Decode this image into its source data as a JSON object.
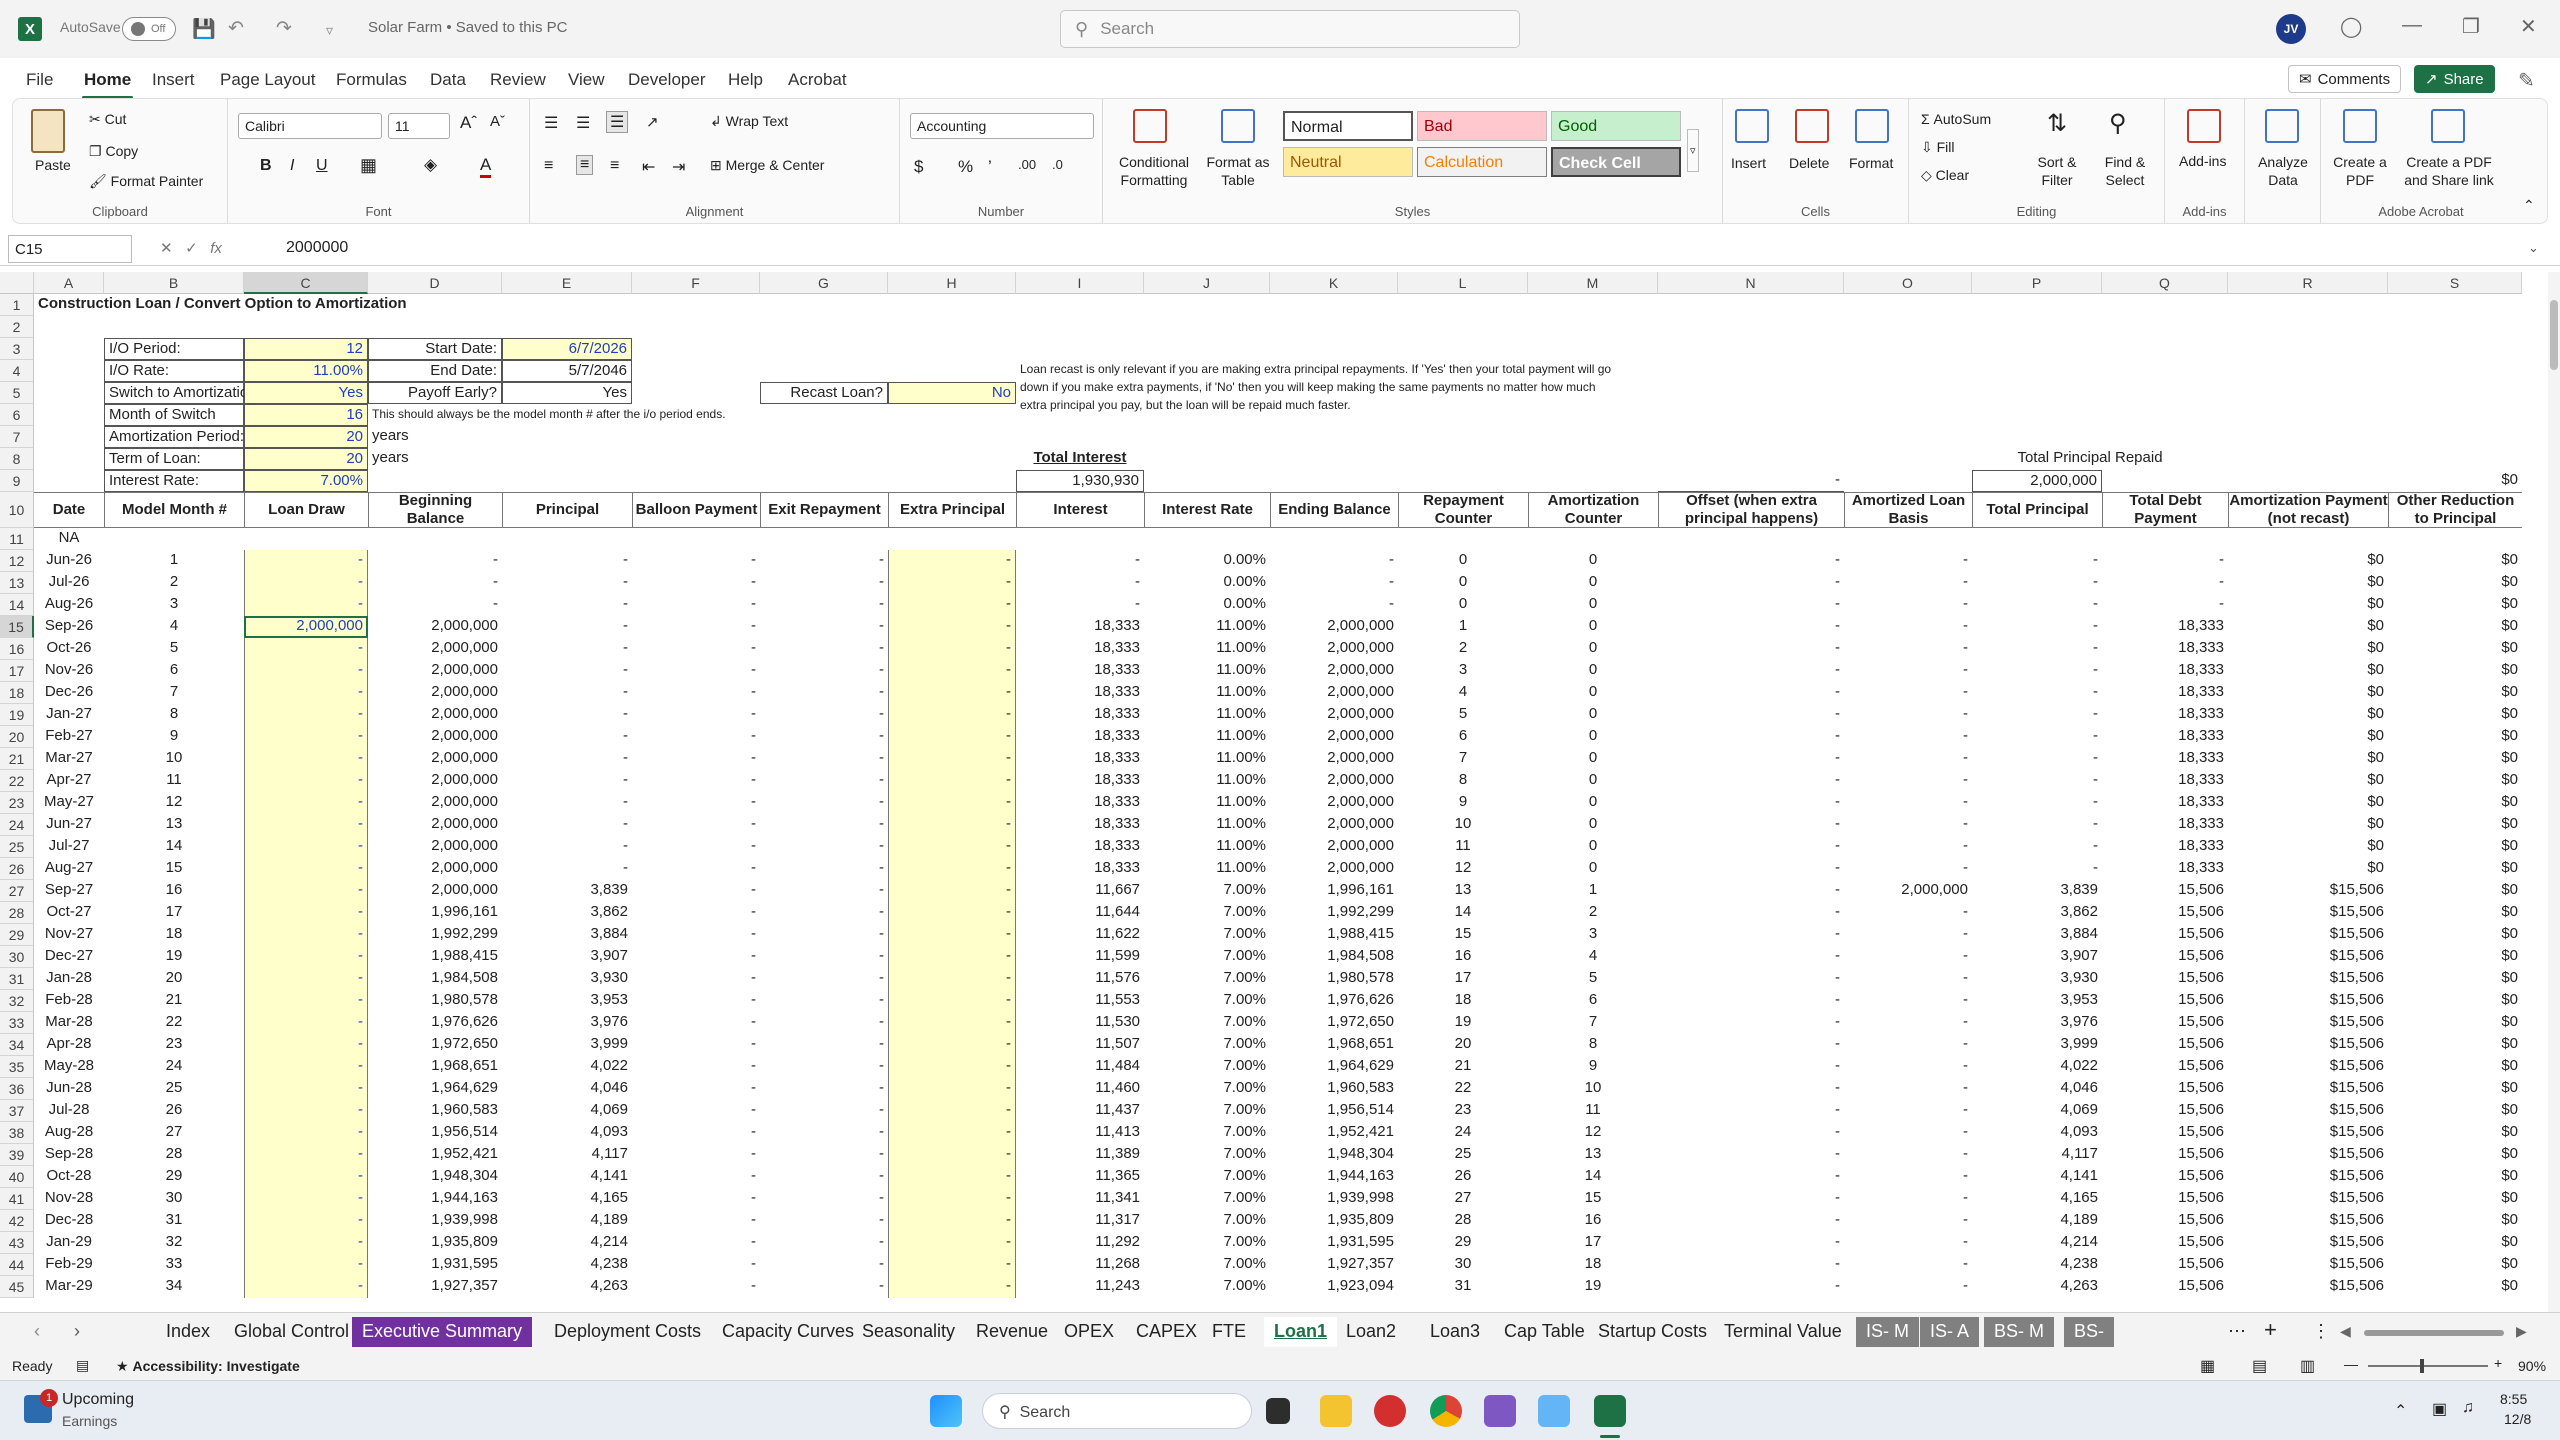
{
  "window": {
    "autosave": "AutoSave",
    "autosave_state": "Off",
    "title": "Solar Farm • Saved to this PC",
    "search_placeholder": "Search",
    "avatar": "JV"
  },
  "menu": {
    "tabs": [
      "File",
      "Home",
      "Insert",
      "Page Layout",
      "Formulas",
      "Data",
      "Review",
      "View",
      "Developer",
      "Help",
      "Acrobat"
    ],
    "comments": "Comments",
    "share": "Share"
  },
  "ribbon": {
    "clipboard": {
      "paste": "Paste",
      "cut": "Cut",
      "copy": "Copy",
      "format_painter": "Format Painter",
      "label": "Clipboard"
    },
    "font": {
      "name": "Calibri",
      "size": "11",
      "label": "Font"
    },
    "alignment": {
      "wrap": "Wrap Text",
      "merge": "Merge & Center",
      "label": "Alignment"
    },
    "number": {
      "format": "Accounting",
      "label": "Number"
    },
    "styles": {
      "cond": "Conditional Formatting",
      "table": "Format as Table",
      "normal": "Normal",
      "bad": "Bad",
      "good": "Good",
      "neutral": "Neutral",
      "calc": "Calculation",
      "check": "Check Cell",
      "label": "Styles"
    },
    "cells": {
      "insert": "Insert",
      "delete": "Delete",
      "format": "Format",
      "label": "Cells"
    },
    "editing": {
      "autosum": "AutoSum",
      "fill": "Fill",
      "clear": "Clear",
      "sort": "Sort & Filter",
      "find": "Find & Select",
      "label": "Editing"
    },
    "addins": {
      "addins": "Add-ins",
      "label": "Add-ins"
    },
    "analyze": {
      "label": "Analyze Data"
    },
    "acrobat": {
      "create": "Create a PDF",
      "share": "Create a PDF and Share link",
      "label": "Adobe Acrobat"
    }
  },
  "formula": {
    "cell": "C15",
    "value": "2000000"
  },
  "sheet": {
    "title": "Construction Loan / Convert Option to Amortization",
    "inputs": [
      [
        "I/O Period:",
        "12",
        "Start Date:",
        "6/7/2026"
      ],
      [
        "I/O Rate:",
        "11.00%",
        "End Date:",
        "5/7/2046"
      ],
      [
        "Switch to Amortization?",
        "Yes",
        "Payoff Early?",
        "Yes"
      ],
      [
        "Month of Switch",
        "16",
        "",
        ""
      ],
      [
        "Amortization Period:",
        "20",
        "",
        ""
      ],
      [
        "Term of Loan:",
        "20",
        "",
        ""
      ],
      [
        "Interest Rate:",
        "7.00%",
        "",
        ""
      ]
    ],
    "note_model": "This should always be the model month # after the i/o period ends.",
    "years": "years",
    "recast_label": "Recast Loan?",
    "recast_value": "No",
    "recast_note": [
      "Loan recast is only relevant if you are making extra principal repayments. If 'Yes' then your total payment will go",
      "down if you make extra payments, if 'No' then you will keep making the same payments no matter how much",
      "extra principal you pay, but the loan will be repaid much faster."
    ],
    "total_interest_label": "Total Interest",
    "total_interest": "1,930,930",
    "total_principal_label": "Total Principal Repaid",
    "offset_total": "-",
    "principal_total": "2,000,000",
    "other_total": "$0",
    "headers": [
      "Date",
      "Model Month #",
      "Loan Draw",
      "Beginning Balance",
      "Principal",
      "Balloon Payment",
      "Exit Repayment",
      "Extra Principal",
      "Interest",
      "Interest Rate",
      "Ending Balance",
      "Repayment Counter",
      "Amortization Counter",
      "Offset (when extra principal happens)",
      "Amortized Loan Basis",
      "Total Principal",
      "Total Debt Payment",
      "Amortization Payment (not recast)",
      "Other Reduction to Principal"
    ],
    "na": "NA",
    "rows": [
      [
        "Jun-26",
        "1",
        "-",
        "-",
        "-",
        "-",
        "-",
        "-",
        "-",
        "0.00%",
        "-",
        "0",
        "0",
        "-",
        "-",
        "-",
        "-",
        "$0",
        "$0"
      ],
      [
        "Jul-26",
        "2",
        "-",
        "-",
        "-",
        "-",
        "-",
        "-",
        "-",
        "0.00%",
        "-",
        "0",
        "0",
        "-",
        "-",
        "-",
        "-",
        "$0",
        "$0"
      ],
      [
        "Aug-26",
        "3",
        "-",
        "-",
        "-",
        "-",
        "-",
        "-",
        "-",
        "0.00%",
        "-",
        "0",
        "0",
        "-",
        "-",
        "-",
        "-",
        "$0",
        "$0"
      ],
      [
        "Sep-26",
        "4",
        "2,000,000",
        "2,000,000",
        "-",
        "-",
        "-",
        "-",
        "18,333",
        "11.00%",
        "2,000,000",
        "1",
        "0",
        "-",
        "-",
        "-",
        "18,333",
        "$0",
        "$0"
      ],
      [
        "Oct-26",
        "5",
        "-",
        "2,000,000",
        "-",
        "-",
        "-",
        "-",
        "18,333",
        "11.00%",
        "2,000,000",
        "2",
        "0",
        "-",
        "-",
        "-",
        "18,333",
        "$0",
        "$0"
      ],
      [
        "Nov-26",
        "6",
        "-",
        "2,000,000",
        "-",
        "-",
        "-",
        "-",
        "18,333",
        "11.00%",
        "2,000,000",
        "3",
        "0",
        "-",
        "-",
        "-",
        "18,333",
        "$0",
        "$0"
      ],
      [
        "Dec-26",
        "7",
        "-",
        "2,000,000",
        "-",
        "-",
        "-",
        "-",
        "18,333",
        "11.00%",
        "2,000,000",
        "4",
        "0",
        "-",
        "-",
        "-",
        "18,333",
        "$0",
        "$0"
      ],
      [
        "Jan-27",
        "8",
        "-",
        "2,000,000",
        "-",
        "-",
        "-",
        "-",
        "18,333",
        "11.00%",
        "2,000,000",
        "5",
        "0",
        "-",
        "-",
        "-",
        "18,333",
        "$0",
        "$0"
      ],
      [
        "Feb-27",
        "9",
        "-",
        "2,000,000",
        "-",
        "-",
        "-",
        "-",
        "18,333",
        "11.00%",
        "2,000,000",
        "6",
        "0",
        "-",
        "-",
        "-",
        "18,333",
        "$0",
        "$0"
      ],
      [
        "Mar-27",
        "10",
        "-",
        "2,000,000",
        "-",
        "-",
        "-",
        "-",
        "18,333",
        "11.00%",
        "2,000,000",
        "7",
        "0",
        "-",
        "-",
        "-",
        "18,333",
        "$0",
        "$0"
      ],
      [
        "Apr-27",
        "11",
        "-",
        "2,000,000",
        "-",
        "-",
        "-",
        "-",
        "18,333",
        "11.00%",
        "2,000,000",
        "8",
        "0",
        "-",
        "-",
        "-",
        "18,333",
        "$0",
        "$0"
      ],
      [
        "May-27",
        "12",
        "-",
        "2,000,000",
        "-",
        "-",
        "-",
        "-",
        "18,333",
        "11.00%",
        "2,000,000",
        "9",
        "0",
        "-",
        "-",
        "-",
        "18,333",
        "$0",
        "$0"
      ],
      [
        "Jun-27",
        "13",
        "-",
        "2,000,000",
        "-",
        "-",
        "-",
        "-",
        "18,333",
        "11.00%",
        "2,000,000",
        "10",
        "0",
        "-",
        "-",
        "-",
        "18,333",
        "$0",
        "$0"
      ],
      [
        "Jul-27",
        "14",
        "-",
        "2,000,000",
        "-",
        "-",
        "-",
        "-",
        "18,333",
        "11.00%",
        "2,000,000",
        "11",
        "0",
        "-",
        "-",
        "-",
        "18,333",
        "$0",
        "$0"
      ],
      [
        "Aug-27",
        "15",
        "-",
        "2,000,000",
        "-",
        "-",
        "-",
        "-",
        "18,333",
        "11.00%",
        "2,000,000",
        "12",
        "0",
        "-",
        "-",
        "-",
        "18,333",
        "$0",
        "$0"
      ],
      [
        "Sep-27",
        "16",
        "-",
        "2,000,000",
        "3,839",
        "-",
        "-",
        "-",
        "11,667",
        "7.00%",
        "1,996,161",
        "13",
        "1",
        "-",
        "2,000,000",
        "3,839",
        "15,506",
        "$15,506",
        "$0"
      ],
      [
        "Oct-27",
        "17",
        "-",
        "1,996,161",
        "3,862",
        "-",
        "-",
        "-",
        "11,644",
        "7.00%",
        "1,992,299",
        "14",
        "2",
        "-",
        "-",
        "3,862",
        "15,506",
        "$15,506",
        "$0"
      ],
      [
        "Nov-27",
        "18",
        "-",
        "1,992,299",
        "3,884",
        "-",
        "-",
        "-",
        "11,622",
        "7.00%",
        "1,988,415",
        "15",
        "3",
        "-",
        "-",
        "3,884",
        "15,506",
        "$15,506",
        "$0"
      ],
      [
        "Dec-27",
        "19",
        "-",
        "1,988,415",
        "3,907",
        "-",
        "-",
        "-",
        "11,599",
        "7.00%",
        "1,984,508",
        "16",
        "4",
        "-",
        "-",
        "3,907",
        "15,506",
        "$15,506",
        "$0"
      ],
      [
        "Jan-28",
        "20",
        "-",
        "1,984,508",
        "3,930",
        "-",
        "-",
        "-",
        "11,576",
        "7.00%",
        "1,980,578",
        "17",
        "5",
        "-",
        "-",
        "3,930",
        "15,506",
        "$15,506",
        "$0"
      ],
      [
        "Feb-28",
        "21",
        "-",
        "1,980,578",
        "3,953",
        "-",
        "-",
        "-",
        "11,553",
        "7.00%",
        "1,976,626",
        "18",
        "6",
        "-",
        "-",
        "3,953",
        "15,506",
        "$15,506",
        "$0"
      ],
      [
        "Mar-28",
        "22",
        "-",
        "1,976,626",
        "3,976",
        "-",
        "-",
        "-",
        "11,530",
        "7.00%",
        "1,972,650",
        "19",
        "7",
        "-",
        "-",
        "3,976",
        "15,506",
        "$15,506",
        "$0"
      ],
      [
        "Apr-28",
        "23",
        "-",
        "1,972,650",
        "3,999",
        "-",
        "-",
        "-",
        "11,507",
        "7.00%",
        "1,968,651",
        "20",
        "8",
        "-",
        "-",
        "3,999",
        "15,506",
        "$15,506",
        "$0"
      ],
      [
        "May-28",
        "24",
        "-",
        "1,968,651",
        "4,022",
        "-",
        "-",
        "-",
        "11,484",
        "7.00%",
        "1,964,629",
        "21",
        "9",
        "-",
        "-",
        "4,022",
        "15,506",
        "$15,506",
        "$0"
      ],
      [
        "Jun-28",
        "25",
        "-",
        "1,964,629",
        "4,046",
        "-",
        "-",
        "-",
        "11,460",
        "7.00%",
        "1,960,583",
        "22",
        "10",
        "-",
        "-",
        "4,046",
        "15,506",
        "$15,506",
        "$0"
      ],
      [
        "Jul-28",
        "26",
        "-",
        "1,960,583",
        "4,069",
        "-",
        "-",
        "-",
        "11,437",
        "7.00%",
        "1,956,514",
        "23",
        "11",
        "-",
        "-",
        "4,069",
        "15,506",
        "$15,506",
        "$0"
      ],
      [
        "Aug-28",
        "27",
        "-",
        "1,956,514",
        "4,093",
        "-",
        "-",
        "-",
        "11,413",
        "7.00%",
        "1,952,421",
        "24",
        "12",
        "-",
        "-",
        "4,093",
        "15,506",
        "$15,506",
        "$0"
      ],
      [
        "Sep-28",
        "28",
        "-",
        "1,952,421",
        "4,117",
        "-",
        "-",
        "-",
        "11,389",
        "7.00%",
        "1,948,304",
        "25",
        "13",
        "-",
        "-",
        "4,117",
        "15,506",
        "$15,506",
        "$0"
      ],
      [
        "Oct-28",
        "29",
        "-",
        "1,948,304",
        "4,141",
        "-",
        "-",
        "-",
        "11,365",
        "7.00%",
        "1,944,163",
        "26",
        "14",
        "-",
        "-",
        "4,141",
        "15,506",
        "$15,506",
        "$0"
      ],
      [
        "Nov-28",
        "30",
        "-",
        "1,944,163",
        "4,165",
        "-",
        "-",
        "-",
        "11,341",
        "7.00%",
        "1,939,998",
        "27",
        "15",
        "-",
        "-",
        "4,165",
        "15,506",
        "$15,506",
        "$0"
      ],
      [
        "Dec-28",
        "31",
        "-",
        "1,939,998",
        "4,189",
        "-",
        "-",
        "-",
        "11,317",
        "7.00%",
        "1,935,809",
        "28",
        "16",
        "-",
        "-",
        "4,189",
        "15,506",
        "$15,506",
        "$0"
      ],
      [
        "Jan-29",
        "32",
        "-",
        "1,935,809",
        "4,214",
        "-",
        "-",
        "-",
        "11,292",
        "7.00%",
        "1,931,595",
        "29",
        "17",
        "-",
        "-",
        "4,214",
        "15,506",
        "$15,506",
        "$0"
      ],
      [
        "Feb-29",
        "33",
        "-",
        "1,931,595",
        "4,238",
        "-",
        "-",
        "-",
        "11,268",
        "7.00%",
        "1,927,357",
        "30",
        "18",
        "-",
        "-",
        "4,238",
        "15,506",
        "$15,506",
        "$0"
      ],
      [
        "Mar-29",
        "34",
        "-",
        "1,927,357",
        "4,263",
        "-",
        "-",
        "-",
        "11,243",
        "7.00%",
        "1,923,094",
        "31",
        "19",
        "-",
        "-",
        "4,263",
        "15,506",
        "$15,506",
        "$0"
      ]
    ]
  },
  "columns": [
    "A",
    "B",
    "C",
    "D",
    "E",
    "F",
    "G",
    "H",
    "I",
    "J",
    "K",
    "L",
    "M",
    "N",
    "O",
    "P",
    "Q",
    "R",
    "S"
  ],
  "sheet_tabs": [
    "Index",
    "Global Control",
    "Executive Summary",
    "Deployment Costs",
    "Capacity Curves",
    "Seasonality",
    "Revenue",
    "OPEX",
    "CAPEX",
    "FTE",
    "Loan1",
    "Loan2",
    "Loan3",
    "Cap Table",
    "Startup Costs",
    "Terminal Value",
    "IS- M",
    "IS- A",
    "BS- M",
    "BS-"
  ],
  "status": {
    "ready": "Ready",
    "accessibility": "Accessibility: Investigate",
    "zoom": "90%"
  },
  "taskbar": {
    "weather_title": "Upcoming",
    "weather_sub": "Earnings",
    "badge": "1",
    "search": "Search",
    "time": "8:55",
    "date": "12/8"
  }
}
